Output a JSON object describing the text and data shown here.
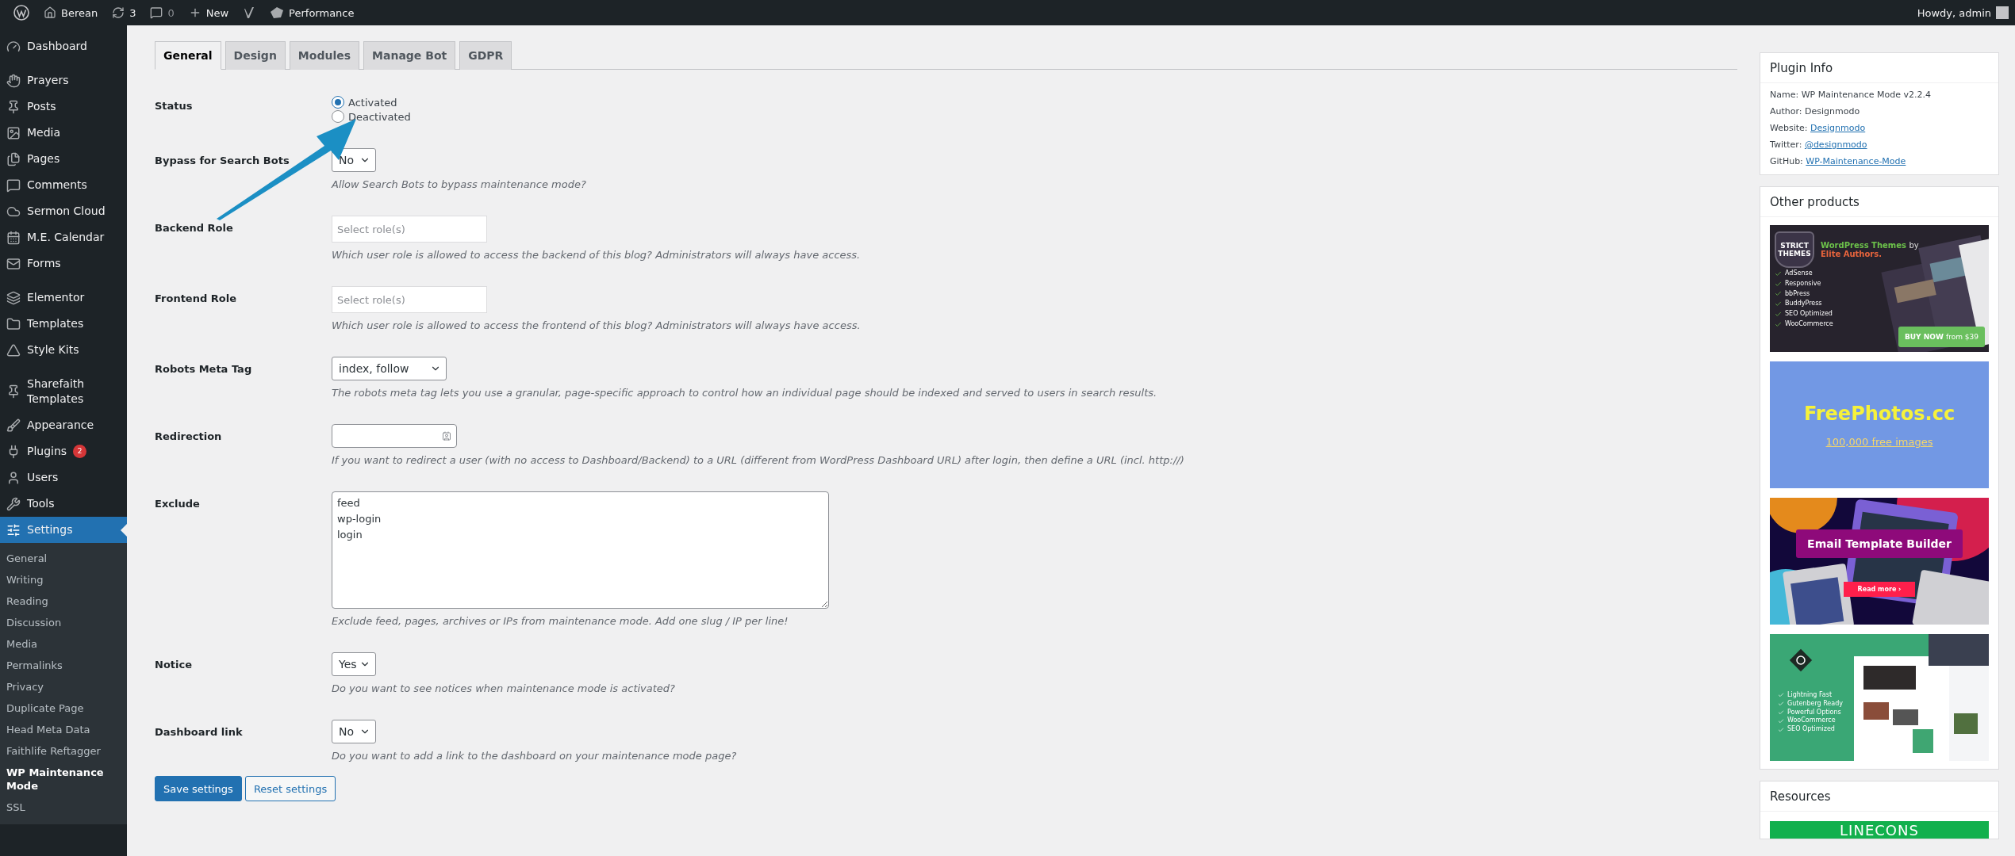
{
  "admin_bar": {
    "items": [
      {
        "kind": "wp"
      },
      {
        "kind": "home",
        "label": "Berean"
      },
      {
        "kind": "updates",
        "label": "3"
      },
      {
        "kind": "comments",
        "label": "0",
        "dim": true
      },
      {
        "kind": "new",
        "label": "New"
      },
      {
        "kind": "yoast"
      },
      {
        "kind": "performance",
        "label": "Performance"
      }
    ],
    "greeting": "Howdy, admin"
  },
  "sidebar": {
    "groups": [
      [
        {
          "kind": "dashboard",
          "label": "Dashboard",
          "selected": false
        }
      ],
      [
        {
          "kind": "prayers",
          "label": "Prayers",
          "selected": false
        },
        {
          "kind": "posts",
          "label": "Posts",
          "selected": false
        },
        {
          "kind": "media",
          "label": "Media",
          "selected": false
        },
        {
          "kind": "pages",
          "label": "Pages",
          "selected": false
        },
        {
          "kind": "comments",
          "label": "Comments",
          "selected": false
        },
        {
          "kind": "cloud",
          "label": "Sermon Cloud",
          "selected": false
        },
        {
          "kind": "calendar",
          "label": "M.E. Calendar",
          "selected": false
        },
        {
          "kind": "forms",
          "label": "Forms",
          "selected": false
        }
      ],
      [
        {
          "kind": "elementor",
          "label": "Elementor",
          "selected": false
        },
        {
          "kind": "templates",
          "label": "Templates",
          "selected": false
        },
        {
          "kind": "stylekits",
          "label": "Style Kits",
          "selected": false
        }
      ],
      [
        {
          "kind": "sharefaith",
          "label": "Sharefaith Templates",
          "selected": false
        },
        {
          "kind": "appearance",
          "label": "Appearance",
          "selected": false
        },
        {
          "kind": "plugins",
          "label": "Plugins",
          "badge": "2",
          "selected": false
        },
        {
          "kind": "users",
          "label": "Users",
          "selected": false
        },
        {
          "kind": "tools",
          "label": "Tools",
          "selected": false
        },
        {
          "kind": "settings",
          "label": "Settings",
          "selected": true,
          "children": [
            {
              "label": "General",
              "selected": false
            },
            {
              "label": "Writing",
              "selected": false
            },
            {
              "label": "Reading",
              "selected": false
            },
            {
              "label": "Discussion",
              "selected": false
            },
            {
              "label": "Media",
              "selected": false
            },
            {
              "label": "Permalinks",
              "selected": false
            },
            {
              "label": "Privacy",
              "selected": false
            },
            {
              "label": "Duplicate Page",
              "selected": false
            },
            {
              "label": "Head Meta Data",
              "selected": false
            },
            {
              "label": "Faithlife Reftagger",
              "selected": false
            },
            {
              "label": "WP Maintenance Mode",
              "selected": true
            },
            {
              "label": "SSL",
              "selected": false
            }
          ]
        }
      ]
    ]
  },
  "tabs": [
    {
      "label": "General",
      "selected": true
    },
    {
      "label": "Design",
      "selected": false
    },
    {
      "label": "Modules",
      "selected": false
    },
    {
      "label": "Manage Bot",
      "selected": false
    },
    {
      "label": "GDPR",
      "selected": false
    }
  ],
  "fields": [
    {
      "kind": "radio",
      "label": "Status",
      "options": [
        {
          "label": "Activated",
          "selected": true
        },
        {
          "label": "Deactivated",
          "selected": false
        }
      ]
    },
    {
      "kind": "select",
      "label": "Bypass for Search Bots",
      "value": "No",
      "help": "Allow Search Bots to bypass maintenance mode?"
    },
    {
      "kind": "roles",
      "label": "Backend Role",
      "placeholder": "Select role(s)",
      "help": "Which user role is allowed to access the backend of this blog? Administrators will always have access."
    },
    {
      "kind": "roles",
      "label": "Frontend Role",
      "placeholder": "Select role(s)",
      "help": "Which user role is allowed to access the frontend of this blog? Administrators will always have access."
    },
    {
      "kind": "wideselect",
      "label": "Robots Meta Tag",
      "value": "index, follow",
      "help": "The robots meta tag lets you use a granular, page-specific approach to control how an individual page should be indexed and served to users in search results."
    },
    {
      "kind": "text",
      "label": "Redirection",
      "help": "If you want to redirect a user (with no access to Dashboard/Backend) to a URL (different from WordPress Dashboard URL) after login, then define a URL (incl. http://)"
    },
    {
      "kind": "textarea",
      "label": "Exclude",
      "value": "feed\nwp-login\nlogin",
      "help": "Exclude feed, pages, archives or IPs from maintenance mode. Add one slug / IP per line!"
    },
    {
      "kind": "select",
      "label": "Notice",
      "value": "Yes",
      "help": "Do you want to see notices when maintenance mode is activated?"
    },
    {
      "kind": "select",
      "label": "Dashboard link",
      "value": "No",
      "help": "Do you want to add a link to the dashboard on your maintenance mode page?"
    }
  ],
  "buttons": [
    {
      "kind": "primary",
      "label": "Save settings"
    },
    {
      "kind": "secondary",
      "label": "Reset settings"
    }
  ],
  "plugin_info": {
    "title": "Plugin Info",
    "rows": [
      {
        "kind": "text",
        "label": "Name:",
        "value": "WP Maintenance Mode v2.2.4"
      },
      {
        "kind": "text",
        "label": "Author:",
        "value": "Designmodo"
      },
      {
        "kind": "link",
        "label": "Website:",
        "value": "Designmodo"
      },
      {
        "kind": "link",
        "label": "Twitter:",
        "value": "@designmodo"
      },
      {
        "kind": "link",
        "label": "GitHub:",
        "value": "WP-Maintenance-Mode"
      }
    ]
  },
  "other_products": {
    "title": "Other products",
    "banners": [
      {
        "kind": "themes",
        "logo": "STRICT THEMES",
        "title": "WordPress Themes",
        "title_tail": "by",
        "subtitle": "Elite Authors.",
        "features": [
          "AdSense",
          "Responsive",
          "bbPress",
          "BuddyPress",
          "SEO Optimized",
          "WooCommerce"
        ],
        "cta": "BUY NOW",
        "price": "from $39"
      },
      {
        "kind": "photos",
        "title": "FreePhotos.cc",
        "link": "100,000 free images"
      },
      {
        "kind": "email",
        "title": "Email Template Builder",
        "cta": "Read more ›"
      },
      {
        "kind": "gutenberg",
        "features": [
          "Lightning Fast",
          "Gutenberg Ready",
          "Powerful Options",
          "WooCommerce",
          "SEO Optimized"
        ]
      }
    ]
  },
  "resources": {
    "title": "Resources",
    "banner": "LINECONS"
  }
}
